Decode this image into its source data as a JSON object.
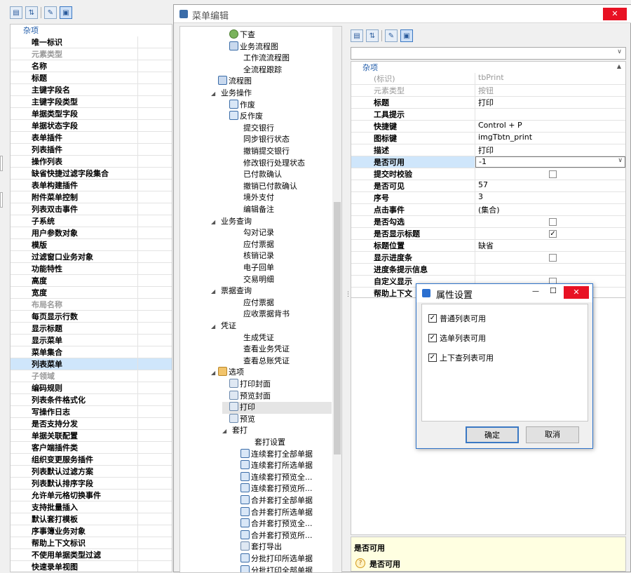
{
  "left_panel": {
    "category": "杂项",
    "rows": [
      {
        "label": "唯一标识",
        "dim": false
      },
      {
        "label": "元素类型",
        "dim": true
      },
      {
        "label": "名称",
        "dim": false
      },
      {
        "label": "标题",
        "dim": false
      },
      {
        "label": "主键字段名",
        "dim": false
      },
      {
        "label": "主键字段类型",
        "dim": false
      },
      {
        "label": "单据类型字段",
        "dim": false
      },
      {
        "label": "单据状态字段",
        "dim": false
      },
      {
        "label": "表单插件",
        "dim": false
      },
      {
        "label": "列表插件",
        "dim": false
      },
      {
        "label": "操作列表",
        "dim": false
      },
      {
        "label": "缺省快捷过滤字段集合",
        "dim": false
      },
      {
        "label": "表单构建插件",
        "dim": false
      },
      {
        "label": "附件菜单控制",
        "dim": false
      },
      {
        "label": "列表双击事件",
        "dim": false
      },
      {
        "label": "子系统",
        "dim": false
      },
      {
        "label": "用户参数对象",
        "dim": false
      },
      {
        "label": "模版",
        "dim": false
      },
      {
        "label": "过滤窗口业务对象",
        "dim": false
      },
      {
        "label": "功能特性",
        "dim": false
      },
      {
        "label": "高度",
        "dim": false
      },
      {
        "label": "宽度",
        "dim": false
      },
      {
        "label": "布局名称",
        "dim": true
      },
      {
        "label": "每页显示行数",
        "dim": false
      },
      {
        "label": "显示标题",
        "dim": false
      },
      {
        "label": "显示菜单",
        "dim": false
      },
      {
        "label": "菜单集合",
        "dim": false
      },
      {
        "label": "列表菜单",
        "dim": false,
        "selected": true
      },
      {
        "label": "子领域",
        "dim": true
      },
      {
        "label": "编码规则",
        "dim": false
      },
      {
        "label": "列表条件格式化",
        "dim": false
      },
      {
        "label": "写操作日志",
        "dim": false
      },
      {
        "label": "是否支持分发",
        "dim": false
      },
      {
        "label": "单据关联配置",
        "dim": false
      },
      {
        "label": "客户端插件类",
        "dim": false
      },
      {
        "label": "组织变更服务插件",
        "dim": false
      },
      {
        "label": "列表默认过滤方案",
        "dim": false
      },
      {
        "label": "列表默认排序字段",
        "dim": false
      },
      {
        "label": "允许单元格切换事件",
        "dim": false
      },
      {
        "label": "支持批量插入",
        "dim": false
      },
      {
        "label": "默认套打模板",
        "dim": false
      },
      {
        "label": "序事簿业务对象",
        "dim": false
      },
      {
        "label": "帮助上下文标识",
        "dim": false
      },
      {
        "label": "不使用单据类型过滤",
        "dim": false
      },
      {
        "label": "快速录单视图",
        "dim": false
      }
    ]
  },
  "dialog": {
    "title": "菜单编辑",
    "close": "✕"
  },
  "tree": [
    {
      "label": "下查",
      "indent": 5,
      "icon": "search-icon",
      "arrow": ""
    },
    {
      "label": "业务流程图",
      "indent": 5,
      "icon": "flowchart-icon",
      "arrow": ""
    },
    {
      "label": "工作流流程图",
      "indent": 6,
      "icon": "",
      "arrow": ""
    },
    {
      "label": "全流程跟踪",
      "indent": 6,
      "icon": "",
      "arrow": ""
    },
    {
      "label": "流程图",
      "indent": 4,
      "icon": "flowchart-icon",
      "arrow": ""
    },
    {
      "label": "业务操作",
      "indent": 4,
      "icon": "",
      "arrow": "◢"
    },
    {
      "label": "作废",
      "indent": 5,
      "icon": "void-icon",
      "arrow": ""
    },
    {
      "label": "反作废",
      "indent": 5,
      "icon": "unvoid-icon",
      "arrow": ""
    },
    {
      "label": "提交银行",
      "indent": 6,
      "icon": "",
      "arrow": ""
    },
    {
      "label": "同步银行状态",
      "indent": 6,
      "icon": "",
      "arrow": ""
    },
    {
      "label": "撤销提交银行",
      "indent": 6,
      "icon": "",
      "arrow": ""
    },
    {
      "label": "修改银行处理状态",
      "indent": 6,
      "icon": "",
      "arrow": ""
    },
    {
      "label": "已付款确认",
      "indent": 6,
      "icon": "",
      "arrow": ""
    },
    {
      "label": "撤销已付款确认",
      "indent": 6,
      "icon": "",
      "arrow": ""
    },
    {
      "label": "境外支付",
      "indent": 6,
      "icon": "",
      "arrow": ""
    },
    {
      "label": "编辑备注",
      "indent": 6,
      "icon": "",
      "arrow": ""
    },
    {
      "label": "业务查询",
      "indent": 4,
      "icon": "",
      "arrow": "◢"
    },
    {
      "label": "勾对记录",
      "indent": 6,
      "icon": "",
      "arrow": ""
    },
    {
      "label": "应付票据",
      "indent": 6,
      "icon": "",
      "arrow": ""
    },
    {
      "label": "核销记录",
      "indent": 6,
      "icon": "",
      "arrow": ""
    },
    {
      "label": "电子回单",
      "indent": 6,
      "icon": "",
      "arrow": ""
    },
    {
      "label": "交易明细",
      "indent": 6,
      "icon": "",
      "arrow": ""
    },
    {
      "label": "票据查询",
      "indent": 4,
      "icon": "",
      "arrow": "◢"
    },
    {
      "label": "应付票据",
      "indent": 6,
      "icon": "",
      "arrow": ""
    },
    {
      "label": "应收票据背书",
      "indent": 6,
      "icon": "",
      "arrow": ""
    },
    {
      "label": "凭证",
      "indent": 4,
      "icon": "",
      "arrow": "◢"
    },
    {
      "label": "生成凭证",
      "indent": 6,
      "icon": "",
      "arrow": ""
    },
    {
      "label": "查看业务凭证",
      "indent": 6,
      "icon": "",
      "arrow": ""
    },
    {
      "label": "查看总账凭证",
      "indent": 6,
      "icon": "",
      "arrow": ""
    },
    {
      "label": "选项",
      "indent": 4,
      "icon": "options-icon",
      "arrow": "◢"
    },
    {
      "label": "打印封面",
      "indent": 5,
      "icon": "printer-icon",
      "arrow": ""
    },
    {
      "label": "预览封面",
      "indent": 5,
      "icon": "preview-icon",
      "arrow": ""
    },
    {
      "label": "打印",
      "indent": 5,
      "icon": "printer-icon",
      "arrow": "",
      "selected": true
    },
    {
      "label": "预览",
      "indent": 5,
      "icon": "preview-icon",
      "arrow": ""
    },
    {
      "label": "套打",
      "indent": 5,
      "icon": "",
      "arrow": "◢"
    },
    {
      "label": "套打设置",
      "indent": 7,
      "icon": "",
      "arrow": ""
    },
    {
      "label": "连续套打全部单据",
      "indent": 6,
      "icon": "batch-print-icon",
      "arrow": ""
    },
    {
      "label": "连续套打所选单据",
      "indent": 6,
      "icon": "batch-print-icon",
      "arrow": ""
    },
    {
      "label": "连续套打预览全...",
      "indent": 6,
      "icon": "batch-print-icon",
      "arrow": ""
    },
    {
      "label": "连续套打预览所...",
      "indent": 6,
      "icon": "batch-print-icon",
      "arrow": ""
    },
    {
      "label": "合并套打全部单据",
      "indent": 6,
      "icon": "merge-print-icon",
      "arrow": ""
    },
    {
      "label": "合并套打所选单据",
      "indent": 6,
      "icon": "batch-print-icon",
      "arrow": ""
    },
    {
      "label": "合并套打预览全...",
      "indent": 6,
      "icon": "batch-print-icon",
      "arrow": ""
    },
    {
      "label": "合并套打预览所...",
      "indent": 6,
      "icon": "batch-print-icon",
      "arrow": ""
    },
    {
      "label": "套打导出",
      "indent": 6,
      "icon": "export-icon",
      "arrow": ""
    },
    {
      "label": "分批打印所选单据",
      "indent": 6,
      "icon": "batch-print-icon",
      "arrow": ""
    },
    {
      "label": "分批打印全部单据",
      "indent": 6,
      "icon": "batch-print-icon",
      "arrow": ""
    }
  ],
  "right_panel": {
    "category": "杂项",
    "rows": [
      {
        "label": "(标识)",
        "value": "tbPrint",
        "dim": true
      },
      {
        "label": "元素类型",
        "value": "按钮",
        "dim": true
      },
      {
        "label": "标题",
        "value": "打印"
      },
      {
        "label": "工具提示",
        "value": ""
      },
      {
        "label": "快捷键",
        "value": "Control + P"
      },
      {
        "label": "图标键",
        "value": "imgTbtn_print"
      },
      {
        "label": "描述",
        "value": "打印"
      },
      {
        "label": "是否可用",
        "value": "-1",
        "selected": true,
        "dropdown": true
      },
      {
        "label": "提交时校验",
        "value": "",
        "check": "unchecked"
      },
      {
        "label": "是否可见",
        "value": "57"
      },
      {
        "label": "序号",
        "value": "3"
      },
      {
        "label": "点击事件",
        "value": "(集合)"
      },
      {
        "label": "是否勾选",
        "value": "",
        "check": "unchecked"
      },
      {
        "label": "是否显示标题",
        "value": "",
        "check": "checked"
      },
      {
        "label": "标题位置",
        "value": "缺省"
      },
      {
        "label": "显示进度条",
        "value": "",
        "check": "unchecked"
      },
      {
        "label": "进度条提示信息",
        "value": ""
      },
      {
        "label": "自定义显示",
        "value": "",
        "check": "unchecked"
      },
      {
        "label": "帮助上下文",
        "value": ""
      }
    ],
    "desc_title": "是否可用",
    "desc_text": "是否可用"
  },
  "popup": {
    "title": "属性设置",
    "options": [
      {
        "label": "普通列表可用",
        "checked": true
      },
      {
        "label": "选单列表可用",
        "checked": true
      },
      {
        "label": "上下查列表可用",
        "checked": true
      }
    ],
    "ok": "确定",
    "cancel": "取消",
    "min": "—",
    "max": "☐",
    "close": "✕"
  },
  "colors": {
    "accent": "#3a78c3",
    "close_red": "#e81123",
    "selection": "#cfe6fb",
    "desc_bg": "#ffffe1"
  }
}
